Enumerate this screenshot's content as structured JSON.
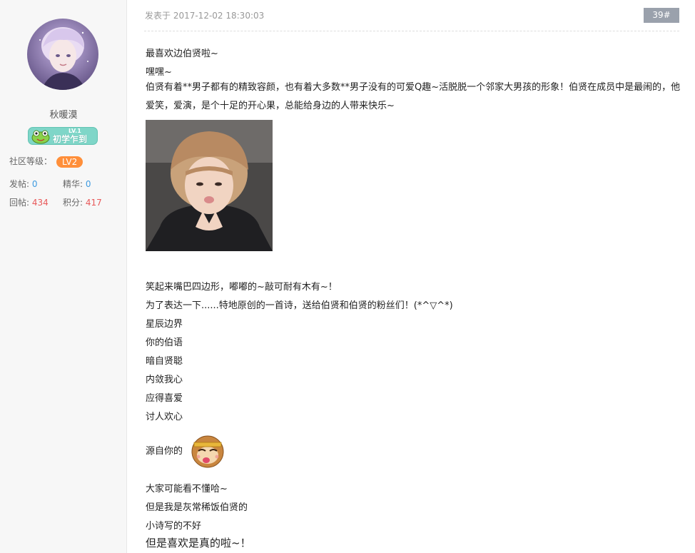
{
  "user": {
    "name": "秋暖漠",
    "rank_level": "LV.1",
    "rank_title": "初学乍到",
    "community_level_label": "社区等级：",
    "community_level": "LV2",
    "posts_label": "发帖:",
    "posts": "0",
    "essence_label": "精华:",
    "essence": "0",
    "replies_label": "回帖:",
    "replies": "434",
    "points_label": "积分:",
    "points": "417"
  },
  "post": {
    "meta": "发表于 2017-12-02 18:30:03",
    "floor": "39#",
    "lines": {
      "l1": "最喜欢边伯贤啦~",
      "l2": "嘿嘿~",
      "p1": "伯贤有着**男子都有的精致容颜，也有着大多数**男子没有的可爱Q趣~活脱脱一个邻家大男孩的形象！伯贤在成员中是最闹的，他爱笑，爱演，是个十足的开心果，总能给身边的人带来快乐~",
      "l3": "笑起来嘴巴四边形，嘟嘟的~敲可耐有木有~！",
      "l4": "为了表达一下......特地原创的一首诗，送给伯贤和伯贤的粉丝们！(*^▽^*)",
      "poem1": "星辰边界",
      "poem2": "你的伯语",
      "poem3": "暗自贤聪",
      "poem4": "内敛我心",
      "poem5": "应得喜爱",
      "poem6": "讨人欢心",
      "source": "源自你的",
      "l5": "大家可能看不懂哈~",
      "l6": "但是我是灰常稀饭伯贤的",
      "l7": "小诗写的不好",
      "l8": "但是喜欢是真的啦~！"
    }
  },
  "colors": {
    "sidebar_bg": "#f7f7f7",
    "level_pill": "#ff8f3a",
    "blue_value": "#3f9be0",
    "red_value": "#e8595a",
    "floor_tag": "#9aa1ac",
    "rank_badge": "#7fd6c8"
  }
}
